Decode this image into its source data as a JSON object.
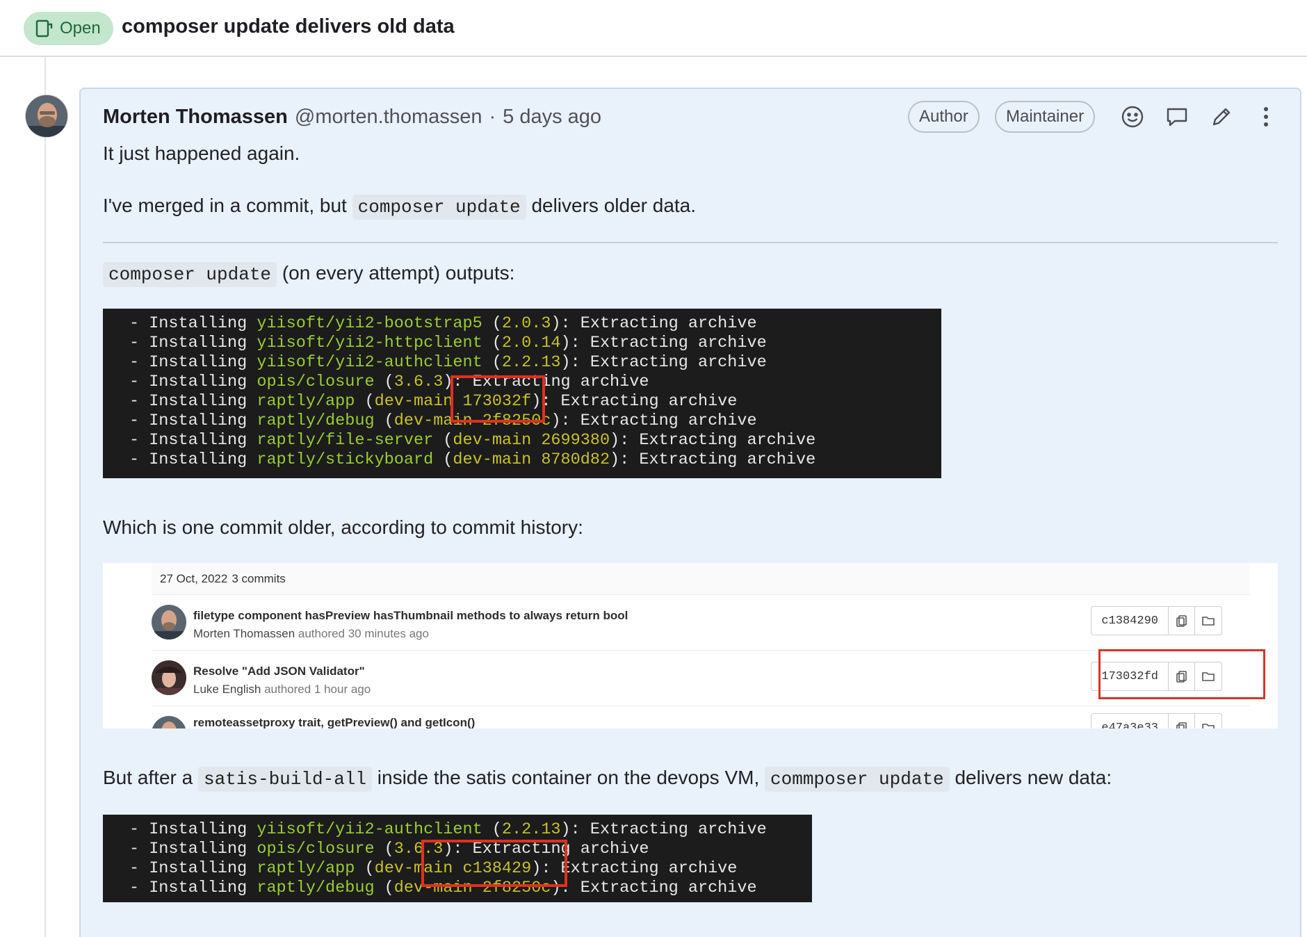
{
  "issue": {
    "status": "Open",
    "title": "composer update delivers old data"
  },
  "note": {
    "author_name": "Morten Thomassen",
    "author_handle": "@morten.thomassen",
    "separator": "·",
    "time": "5 days ago",
    "badges": [
      "Author",
      "Maintainer"
    ],
    "actions": [
      "emoji-icon",
      "comment-icon",
      "pencil-icon",
      "more-actions-icon"
    ]
  },
  "body": {
    "p1": "It just happened again.",
    "p2_a": "I've merged in a commit, but",
    "p2_code": "composer update",
    "p2_b": "delivers older data.",
    "p3_code": "composer update",
    "p3_b": "(on every attempt) outputs:",
    "p4": "Which is one commit older, according to commit history:",
    "p5_a": "But after a",
    "p5_code1": "satis-build-all",
    "p5_b": "inside the satis container on the devops VM,",
    "p5_code2": "commposer update",
    "p5_c": "delivers new data:"
  },
  "terminal1": {
    "lines": [
      {
        "pre": "- Installing ",
        "pkg": "yiisoft/yii2-bootstrap5",
        "mid": " (",
        "ver": "2.0.3",
        "post": "): Extracting archive"
      },
      {
        "pre": "- Installing ",
        "pkg": "yiisoft/yii2-httpclient",
        "mid": " (",
        "ver": "2.0.14",
        "post": "): Extracting archive"
      },
      {
        "pre": "- Installing ",
        "pkg": "yiisoft/yii2-authclient",
        "mid": " (",
        "ver": "2.2.13",
        "post": "): Extracting archive"
      },
      {
        "pre": "- Installing ",
        "pkg": "opis/closure",
        "mid": " (",
        "ver": "3.6.3",
        "post": "): Extracting archive"
      },
      {
        "pre": "- Installing ",
        "pkg": "raptly/app",
        "mid": " (",
        "ver": "dev-main 173032f",
        "post": "): Extracting archive"
      },
      {
        "pre": "- Installing ",
        "pkg": "raptly/debug",
        "mid": " (",
        "ver": "dev-main 2f8250c",
        "post": "): Extracting archive"
      },
      {
        "pre": "- Installing ",
        "pkg": "raptly/file-server",
        "mid": " (",
        "ver": "dev-main 2699380",
        "post": "): Extracting archive"
      },
      {
        "pre": "- Installing ",
        "pkg": "raptly/stickyboard",
        "mid": " (",
        "ver": "dev-main 8780d82",
        "post": "): Extracting archive"
      }
    ]
  },
  "terminal2": {
    "lines": [
      {
        "pre": "- Installing ",
        "pkg": "yiisoft/yii2-authclient",
        "mid": " (",
        "ver": "2.2.13",
        "post": "): Extracting archive"
      },
      {
        "pre": "- Installing ",
        "pkg": "opis/closure",
        "mid": " (",
        "ver": "3.6.3",
        "post": "): Extracting archive"
      },
      {
        "pre": "- Installing ",
        "pkg": "raptly/app",
        "mid": " (",
        "ver": "dev-main c138429",
        "post": "): Extracting archive"
      },
      {
        "pre": "- Installing ",
        "pkg": "raptly/debug",
        "mid": " (",
        "ver": "dev-main 2f8250c",
        "post": "): Extracting archive"
      }
    ]
  },
  "commits": {
    "date": "27 Oct, 2022",
    "count": "3 commits",
    "items": [
      {
        "title": "filetype component hasPreview hasThumbnail methods to always return bool",
        "author": "Morten Thomassen",
        "authored": "authored 30 minutes ago",
        "sha": "c1384290"
      },
      {
        "title": "Resolve \"Add JSON Validator\"",
        "author": "Luke English",
        "authored": "authored 1 hour ago",
        "sha": "173032fd"
      },
      {
        "title": "remoteassetproxy trait, getPreview() and getIcon()",
        "author": "",
        "authored": "",
        "sha": "e47a3e33"
      }
    ]
  },
  "colors": {
    "open_badge_bg": "#c3e6cd",
    "open_badge_text": "#24663b",
    "note_bg": "#e9f1fb",
    "terminal_bg": "#1c1c1c",
    "highlight_red": "#e0301e"
  }
}
